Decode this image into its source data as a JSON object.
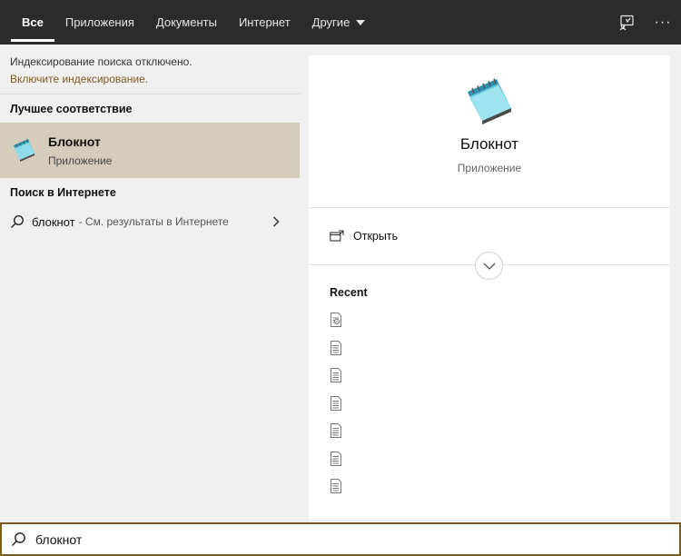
{
  "tabs": [
    {
      "label": "Все",
      "active": true
    },
    {
      "label": "Приложения"
    },
    {
      "label": "Документы"
    },
    {
      "label": "Интернет"
    },
    {
      "label": "Другие"
    }
  ],
  "topbar_icons": [
    "feedback-icon",
    "more-icon"
  ],
  "more_label": "···",
  "left": {
    "index_note": "Индексирование поиска отключено.",
    "index_link": "Включите индексирование.",
    "best_match_header": "Лучшее соответствие",
    "best_match": {
      "name": "Блокнот",
      "type": "Приложение",
      "icon": "notepad-icon"
    },
    "web_header": "Поиск в Интернете",
    "web_item": {
      "query": "блокнот",
      "hint": "- См. результаты в Интернете"
    }
  },
  "right": {
    "app_name": "Блокнот",
    "app_type": "Приложение",
    "open_label": "Открыть",
    "recent_header": "Recent",
    "recent_items": [
      "text-file-icon",
      "document-icon",
      "document-icon",
      "document-icon",
      "document-icon",
      "document-icon",
      "document-icon"
    ]
  },
  "search": {
    "value": "блокнот"
  },
  "colors": {
    "accent": "#7a5c1b",
    "selected_bg": "#d5ccbb",
    "topbar_bg": "#2b2b2b"
  }
}
